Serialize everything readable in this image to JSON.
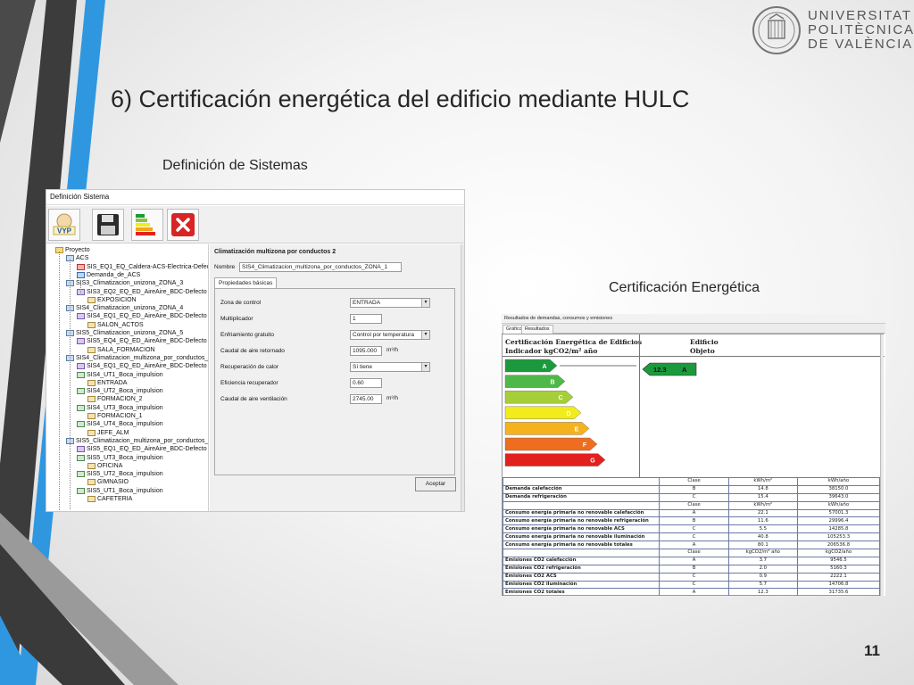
{
  "slide": {
    "title": "6) Certificación energética del edificio mediante HULC",
    "subhead_left": "Definición de Sistemas",
    "subhead_right": "Certificación Energética",
    "number": "11"
  },
  "logo": {
    "lines": [
      "UNIVERSITAT",
      "POLITÈCNICA",
      "DE VALÈNCIA"
    ]
  },
  "colors": {
    "stripe_dark": "#3c3c3c",
    "stripe_blue": "#2f97e0",
    "stripe_gray": "#9a9a9a"
  },
  "sistema": {
    "window_title": "Definición Sistema",
    "toolbar": [
      {
        "icon": "vyp-icon",
        "label": "VYP"
      },
      {
        "icon": "save-icon",
        "label": ""
      },
      {
        "icon": "energy-rating-icon",
        "label": ""
      },
      {
        "icon": "close-icon",
        "label": ""
      }
    ],
    "tree": [
      {
        "label": "Proyecto",
        "icon": "folder"
      },
      {
        "label": "ACS",
        "icon": "sys"
      },
      {
        "label": "SIS_EQ1_EQ_Caldera-ACS-Electrica-Defecto",
        "icon": "red"
      },
      {
        "label": "Demanda_de_ACS",
        "icon": "blue"
      },
      {
        "label": "SIS3_Climatizacion_unizona_ZONA_3",
        "icon": "sys"
      },
      {
        "label": "SIS3_EQ2_EQ_ED_AireAire_BDC-Defecto",
        "icon": "eq"
      },
      {
        "label": "EXPOSICION",
        "icon": "zone"
      },
      {
        "label": "SIS4_Climatizacion_unizona_ZONA_4",
        "icon": "sys"
      },
      {
        "label": "SIS4_EQ1_EQ_ED_AireAire_BDC-Defecto",
        "icon": "eq"
      },
      {
        "label": "SALON_ACTOS",
        "icon": "zone"
      },
      {
        "label": "SIS5_Climatizacion_unizona_ZONA_5",
        "icon": "sys"
      },
      {
        "label": "SIS5_EQ4_EQ_ED_AireAire_BDC-Defecto",
        "icon": "eq"
      },
      {
        "label": "SALA_FORMACION",
        "icon": "zone"
      },
      {
        "label": "SIS4_Climatizacion_multizona_por_conductos_",
        "icon": "sys"
      },
      {
        "label": "SIS4_EQ1_EQ_ED_AireAire_BDC-Defecto",
        "icon": "eq"
      },
      {
        "label": "SIS4_UT1_Boca_impulsion",
        "icon": "ut"
      },
      {
        "label": "ENTRADA",
        "icon": "zone"
      },
      {
        "label": "SIS4_UT2_Boca_impulsion",
        "icon": "ut"
      },
      {
        "label": "FORMACION_2",
        "icon": "zone"
      },
      {
        "label": "SIS4_UT3_Boca_impulsion",
        "icon": "ut"
      },
      {
        "label": "FORMACION_1",
        "icon": "zone"
      },
      {
        "label": "SIS4_UT4_Boca_impulsion",
        "icon": "ut"
      },
      {
        "label": "JEFE_ALM",
        "icon": "zone"
      },
      {
        "label": "SIS5_Climatizacion_multizona_por_conductos_",
        "icon": "sys"
      },
      {
        "label": "SIS5_EQ1_EQ_ED_AireAire_BDC-Defecto",
        "icon": "eq"
      },
      {
        "label": "SIS5_UT3_Boca_impulsion",
        "icon": "ut"
      },
      {
        "label": "OFICINA",
        "icon": "zone"
      },
      {
        "label": "SIS5_UT2_Boca_impulsion",
        "icon": "ut"
      },
      {
        "label": "GIMNASIO",
        "icon": "zone"
      },
      {
        "label": "SIS5_UT1_Boca_impulsion",
        "icon": "ut"
      },
      {
        "label": "CAFETERIA",
        "icon": "zone"
      }
    ],
    "panel_title": "Climatización multizona por conductos 2",
    "nombre_label": "Nombre",
    "nombre_value": "SIS4_Climatizacion_multizona_por_conductos_ZONA_1",
    "tab_label": "Propiedades básicas",
    "fields": [
      {
        "label": "Zona de control",
        "value": "ENTRADA",
        "type": "dropdown",
        "unit": ""
      },
      {
        "label": "Multiplicador",
        "value": "1",
        "type": "input",
        "unit": ""
      },
      {
        "label": "Enfriamiento gratuito",
        "value": "Control por temperatura",
        "type": "dropdown",
        "unit": ""
      },
      {
        "label": "Caudal de aire retornado",
        "value": "1095.000",
        "type": "input",
        "unit": "m³/h"
      },
      {
        "label": "Recuperación de calor",
        "value": "Sí tiene",
        "type": "dropdown",
        "unit": ""
      },
      {
        "label": "Eficiencia recuperador",
        "value": "0.60",
        "type": "input",
        "unit": ""
      },
      {
        "label": "Caudal de aire ventilación",
        "value": "2745.00",
        "type": "input",
        "unit": "m³/h"
      }
    ],
    "accept_label": "Aceptar"
  },
  "certificacion": {
    "window_title": "Resultados de demandas, consumos y emisiones",
    "tabs": [
      "Gráfico",
      "Resultados"
    ],
    "header_left": [
      "Certificación Energética de Edificios",
      "Indicador kgCO2/m² año"
    ],
    "header_right": [
      "Edificio",
      "Objeto"
    ],
    "rating_value": "12.3",
    "rating_letter": "A",
    "table": {
      "sections": [
        {
          "header": [
            "",
            "Clase",
            "kWh/m²",
            "kWh/año"
          ],
          "rows": [
            [
              "Demanda calefacción",
              "B",
              "14.8",
              "38150.0"
            ],
            [
              "Demanda refrigeración",
              "C",
              "15.4",
              "39643.0"
            ]
          ]
        },
        {
          "header": [
            "",
            "Clase",
            "kWh/m²",
            "kWh/año"
          ],
          "rows": [
            [
              "Consumo energía primaria no renovable calefacción",
              "A",
              "22.1",
              "57001.3"
            ],
            [
              "Consumo energía primaria no renovable refrigeración",
              "B",
              "11.6",
              "29996.4"
            ],
            [
              "Consumo energía primaria no renovable ACS",
              "C",
              "5.5",
              "14285.8"
            ],
            [
              "Consumo energía primaria no renovable iluminación",
              "C",
              "40.8",
              "105253.3"
            ],
            [
              "Consumo energía primaria no renovable totales",
              "A",
              "80.1",
              "206536.8"
            ]
          ]
        },
        {
          "header": [
            "",
            "Clase",
            "kgCO2/m² año",
            "kgCO2/año"
          ],
          "rows": [
            [
              "Emisiones CO2 calefacción",
              "A",
              "3.7",
              "9546.5"
            ],
            [
              "Emisiones CO2 refrigeración",
              "B",
              "2.0",
              "5160.3"
            ],
            [
              "Emisiones CO2 ACS",
              "C",
              "0.9",
              "2222.1"
            ],
            [
              "Emisiones CO2 iluminación",
              "C",
              "5.7",
              "14706.8"
            ],
            [
              "Emisiones CO2 totales",
              "A",
              "12.3",
              "31735.6"
            ]
          ]
        }
      ]
    },
    "classes": [
      {
        "letter": "A",
        "color": "#1a9a3c"
      },
      {
        "letter": "B",
        "color": "#4fb848"
      },
      {
        "letter": "C",
        "color": "#a5cf3a"
      },
      {
        "letter": "D",
        "color": "#f2ec1a"
      },
      {
        "letter": "E",
        "color": "#f6b21c"
      },
      {
        "letter": "F",
        "color": "#ef6d1f"
      },
      {
        "letter": "G",
        "color": "#e2211f"
      }
    ]
  }
}
